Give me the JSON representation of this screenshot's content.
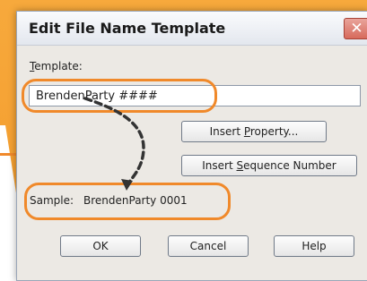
{
  "dialog": {
    "title": "Edit File Name Template",
    "close_glyph": "✕"
  },
  "template": {
    "label": "Template:",
    "value": "BrendenParty ####"
  },
  "buttons": {
    "insert_property": "Insert Property...",
    "insert_sequence": "Insert Sequence Number",
    "ok": "OK",
    "cancel": "Cancel",
    "help": "Help"
  },
  "sample": {
    "label": "Sample:",
    "value": "BrendenParty 0001"
  },
  "colors": {
    "accent": "#f0892a",
    "background_orange": "#f39a2a"
  },
  "icons": {
    "close": "close-icon",
    "arrow": "curved-arrow-icon"
  }
}
